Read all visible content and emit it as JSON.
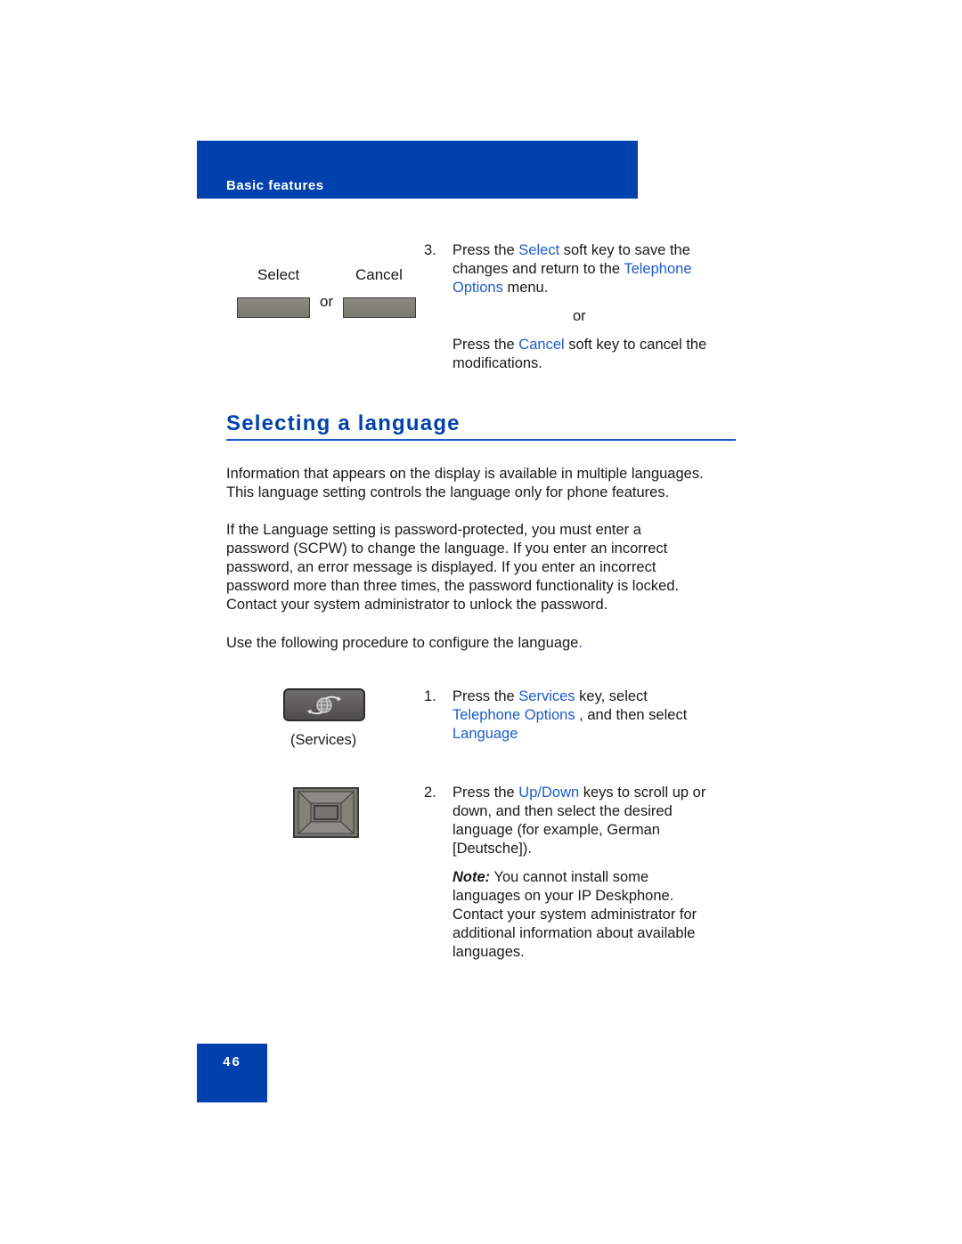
{
  "header": {
    "section": "Basic features"
  },
  "softkeys": {
    "select_label": "Select",
    "cancel_label": "Cancel",
    "or_label": "or"
  },
  "step3": {
    "number": "3.",
    "line_parts": [
      {
        "text": "Press the ",
        "style": "plain"
      },
      {
        "text": "Select",
        "style": "blue"
      },
      {
        "text": " soft key to save the changes and return to the ",
        "style": "plain"
      },
      {
        "text": "Telephone Options",
        "style": "blue"
      },
      {
        "text": " menu.",
        "style": "plain"
      }
    ],
    "p1": "Press the ",
    "p1_link": "Select",
    "p2": " soft key to save the",
    "p3": "changes and return to the ",
    "p3_link": "Telephone",
    "p4_link": "Options",
    "p4": " menu.",
    "or": "or",
    "alt_p1": "Press the ",
    "alt_link": "Cancel",
    "alt_p2": " soft key to cancel the",
    "alt_p3": "modifications."
  },
  "section": {
    "title": "Selecting a language",
    "para1_l1": "Information that appears on the display is available in multiple languages.",
    "para1_l2": "This language setting controls the language only for phone features.",
    "para2_lines": [
      "If the Language setting is password-protected, you must enter a",
      "password (SCPW) to change the language. If you enter an incorrect",
      "password, an error message is displayed. If you enter an incorrect",
      "password more than three times, the password functionality is locked.",
      "Contact your system administrator to unlock the password."
    ],
    "para3": "Use the following procedure to configure the language",
    "para3_end": "."
  },
  "services_key": {
    "icon": "services-globe-icon",
    "caption": "(Services)"
  },
  "nav_key": {
    "icon": "navigation-cluster-icon"
  },
  "step1": {
    "number": "1.",
    "p1": "Press the ",
    "link1": "Services",
    "p2": " key, select",
    "link2": "Telephone Options",
    "p3": " , and then select",
    "link3": "Language"
  },
  "step2": {
    "number": "2.",
    "p1": "Press the ",
    "link1": "Up/Down",
    "p2": " keys to scroll up or",
    "l2": "down, and then select the desired",
    "l3": "language (for example, German",
    "l4": "[Deutsche])."
  },
  "note": {
    "label": "Note:",
    "l1": " You cannot install some",
    "l2": "languages on your IP Deskphone.",
    "l3": "Contact your system administrator for",
    "l4": "additional information about available",
    "l5": "languages."
  },
  "footer": {
    "page_number": "46"
  },
  "colors": {
    "brand_blue": "#0041ad",
    "link_blue": "#1e5cc8"
  }
}
